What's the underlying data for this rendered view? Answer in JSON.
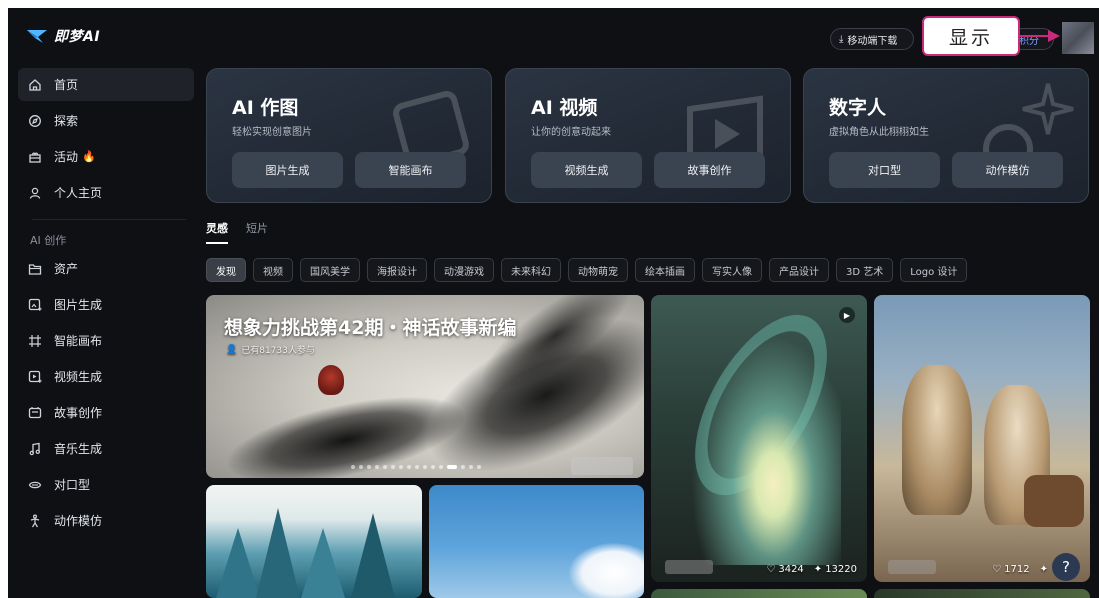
{
  "app": {
    "logo_text": "即梦AI"
  },
  "sidebar": {
    "items": [
      {
        "label": "首页",
        "icon": "home-icon"
      },
      {
        "label": "探索",
        "icon": "compass-icon"
      },
      {
        "label": "活动",
        "icon": "gift-icon"
      },
      {
        "label": "个人主页",
        "icon": "user-icon"
      }
    ],
    "section_title": "AI 创作",
    "create_items": [
      {
        "label": "资产",
        "icon": "folder-icon"
      },
      {
        "label": "图片生成",
        "icon": "image-gen-icon"
      },
      {
        "label": "智能画布",
        "icon": "canvas-icon"
      },
      {
        "label": "视频生成",
        "icon": "video-gen-icon"
      },
      {
        "label": "故事创作",
        "icon": "story-icon"
      },
      {
        "label": "音乐生成",
        "icon": "music-icon"
      },
      {
        "label": "对口型",
        "icon": "lipsync-icon"
      },
      {
        "label": "动作模仿",
        "icon": "motion-icon"
      }
    ]
  },
  "topbar": {
    "download_label": "移动端下载",
    "points_label": "积分",
    "callout_text": "显示"
  },
  "cards": [
    {
      "title": "AI 作图",
      "subtitle": "轻松实现创意图片",
      "btn1": "图片生成",
      "btn2": "智能画布"
    },
    {
      "title": "AI 视频",
      "subtitle": "让你的创意动起来",
      "btn1": "视频生成",
      "btn2": "故事创作"
    },
    {
      "title": "数字人",
      "subtitle": "虚拟角色从此栩栩如生",
      "btn1": "对口型",
      "btn2": "动作模仿"
    }
  ],
  "tabs": [
    "灵感",
    "短片"
  ],
  "chips": [
    "发现",
    "视频",
    "国风美学",
    "海报设计",
    "动漫游戏",
    "未来科幻",
    "动物萌宠",
    "绘本插画",
    "写实人像",
    "产品设计",
    "3D 艺术",
    "Logo 设计"
  ],
  "banner": {
    "title": "想象力挑战第42期・神话故事新编",
    "participants": "已有81733人参与"
  },
  "tiles": [
    {
      "likes": "3424",
      "uses": "13220"
    },
    {
      "likes": "1712"
    }
  ],
  "help_label": "?"
}
